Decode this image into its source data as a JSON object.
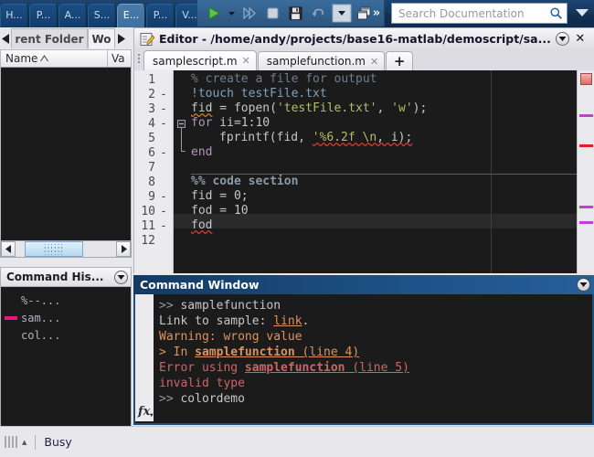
{
  "ribbon": {
    "tabs": [
      {
        "label": "H...",
        "selected": false
      },
      {
        "label": "P...",
        "selected": false
      },
      {
        "label": "A...",
        "selected": false
      },
      {
        "label": "S...",
        "selected": false
      },
      {
        "label": "E...",
        "selected": true
      },
      {
        "label": "P...",
        "selected": false
      },
      {
        "label": "V...",
        "selected": false
      }
    ],
    "toolbar": [
      {
        "name": "run-button",
        "icon": "play-icon"
      },
      {
        "name": "run-options-dropdown",
        "icon": "caret-down-icon"
      },
      {
        "name": "run-advance-button",
        "icon": "fast-forward-icon"
      },
      {
        "name": "stop-button",
        "icon": "stop-square-icon"
      },
      {
        "name": "save-button",
        "icon": "floppy-disk-icon"
      },
      {
        "name": "undo-button",
        "icon": "undo-arrow-icon"
      },
      {
        "name": "undo-dropdown",
        "icon": "caret-down-icon"
      },
      {
        "name": "new-window-button",
        "icon": "cascade-windows-icon"
      }
    ],
    "overflow_label": "»",
    "search": {
      "placeholder": "Search Documentation",
      "value": "",
      "icon": "search-icon"
    },
    "expand_icon": "chevron-down-icon"
  },
  "left_panel": {
    "tabs": [
      {
        "label": "rent Folder",
        "selected": false
      },
      {
        "label": "Wo",
        "selected": true
      }
    ],
    "nav_prev_icon": "triangle-left-icon",
    "nav_next_icon": "triangle-right-icon",
    "columns": [
      {
        "label": "Name",
        "sort_icon": "sort-ascending-icon"
      },
      {
        "label": "Va"
      }
    ],
    "scrollbar": {
      "left_icon": "triangle-left-icon",
      "right_icon": "triangle-right-icon"
    },
    "history": {
      "title": "Command His...",
      "expand_icon": "circle-chevron-down-icon",
      "items": [
        {
          "text": "%--...",
          "marked": false,
          "mark_color": ""
        },
        {
          "text": "sam...",
          "marked": true,
          "mark_color": "#e5187a"
        },
        {
          "text": "col...",
          "marked": false,
          "mark_color": ""
        }
      ]
    }
  },
  "editor": {
    "title": "Editor - /home/andy/projects/base16-matlab/demoscript/sa...",
    "title_icon": "editor-pencil-icon",
    "expand_icon": "circle-chevron-down-icon",
    "close_icon": "close-x-icon",
    "tabs": [
      {
        "label": "samplescript.m",
        "selected": true,
        "close_icon": "close-x-icon"
      },
      {
        "label": "samplefunction.m",
        "selected": false,
        "close_icon": "close-x-icon"
      }
    ],
    "new_tab_label": "+",
    "lines": [
      {
        "num": "1",
        "dash": false,
        "highlight": false
      },
      {
        "num": "2",
        "dash": true,
        "highlight": false
      },
      {
        "num": "3",
        "dash": true,
        "highlight": false
      },
      {
        "num": "4",
        "dash": true,
        "highlight": false
      },
      {
        "num": "5",
        "dash": false,
        "highlight": false
      },
      {
        "num": "6",
        "dash": true,
        "highlight": false
      },
      {
        "num": "7",
        "dash": false,
        "highlight": false
      },
      {
        "num": "8",
        "dash": false,
        "highlight": false
      },
      {
        "num": "9",
        "dash": true,
        "highlight": false
      },
      {
        "num": "10",
        "dash": true,
        "highlight": true
      },
      {
        "num": "11",
        "dash": true,
        "highlight": false
      },
      {
        "num": "12",
        "dash": false,
        "highlight": false
      }
    ],
    "code_text": {
      "l1": "% create a file for output",
      "l2_bang": "!touch testFile.txt",
      "l3_a": "fid",
      "l3_b": " = fopen(",
      "l3_c": "'testFile.txt'",
      "l3_d": ", ",
      "l3_e": "'w'",
      "l3_f": ");",
      "l4_kw": "for",
      "l4_rest": " ii=1:10",
      "l5_a": "fprintf(fid, ",
      "l5_b": "'%6.2f \\n",
      "l5_c": ", i);",
      "l6_kw": "end",
      "l8": "%% code section",
      "l9": "fid = 0;",
      "l10": "fod = 10",
      "l11": "fod"
    },
    "markers": [
      {
        "name": "error-marker",
        "color": "#e06a62",
        "type": "square"
      },
      {
        "name": "warning-mark-1",
        "color": "#c43bd6",
        "type": "bar"
      },
      {
        "name": "error-mark-2",
        "color": "#e02020",
        "type": "bar"
      },
      {
        "name": "warning-mark-3",
        "color": "#c43bd6",
        "type": "bar"
      },
      {
        "name": "warning-mark-4",
        "color": "#c43bd6",
        "type": "bar"
      }
    ]
  },
  "command_window": {
    "title": "Command Window",
    "expand_icon": "circle-chevron-down-icon",
    "fx_label": "fx",
    "lines": {
      "p1_prompt": ">> ",
      "p1_cmd": "samplefunction",
      "l2_a": "Link to sample: ",
      "l2_link": "link",
      "l2_b": ".",
      "l3": "Warning: wrong value",
      "l4_a": "> In ",
      "l4_b": "samplefunction",
      "l4_c": " (line 4)",
      "l5_a": "Error using ",
      "l5_b": "samplefunction",
      "l5_c": " (line 5)",
      "l6": "invalid type",
      "p2_prompt": ">> ",
      "p2_cmd": "colordemo"
    }
  },
  "status_bar": {
    "grip_icon": "resize-grip-icon",
    "text": "Busy"
  },
  "colors": {
    "editor_bg": "#1b1b1b",
    "comment": "#7d8a99",
    "string": "#b5bd68",
    "keyword": "#b294bb",
    "identifier": "#c5c8c6",
    "system_cmd": "#81a2be",
    "error_red": "#cc6666",
    "warning_orange": "#de935f",
    "link_blue": "#81a2be",
    "ribbon_blue": "#17365c"
  }
}
